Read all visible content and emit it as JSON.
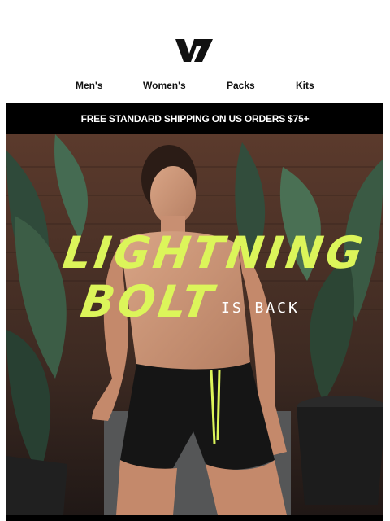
{
  "brand": {
    "logo_icon": "vw-logo-icon",
    "color": "#111111"
  },
  "nav": {
    "items": [
      {
        "label": "Men's"
      },
      {
        "label": "Women's"
      },
      {
        "label": "Packs"
      },
      {
        "label": "Kits"
      }
    ]
  },
  "banner": {
    "text": "FREE STANDARD SHIPPING ON US ORDERS $75+"
  },
  "hero": {
    "headline_line1": "LIGHTNING",
    "headline_line2": "BOLT",
    "subline": "IS BACK",
    "accent_color": "#dcf55a"
  }
}
